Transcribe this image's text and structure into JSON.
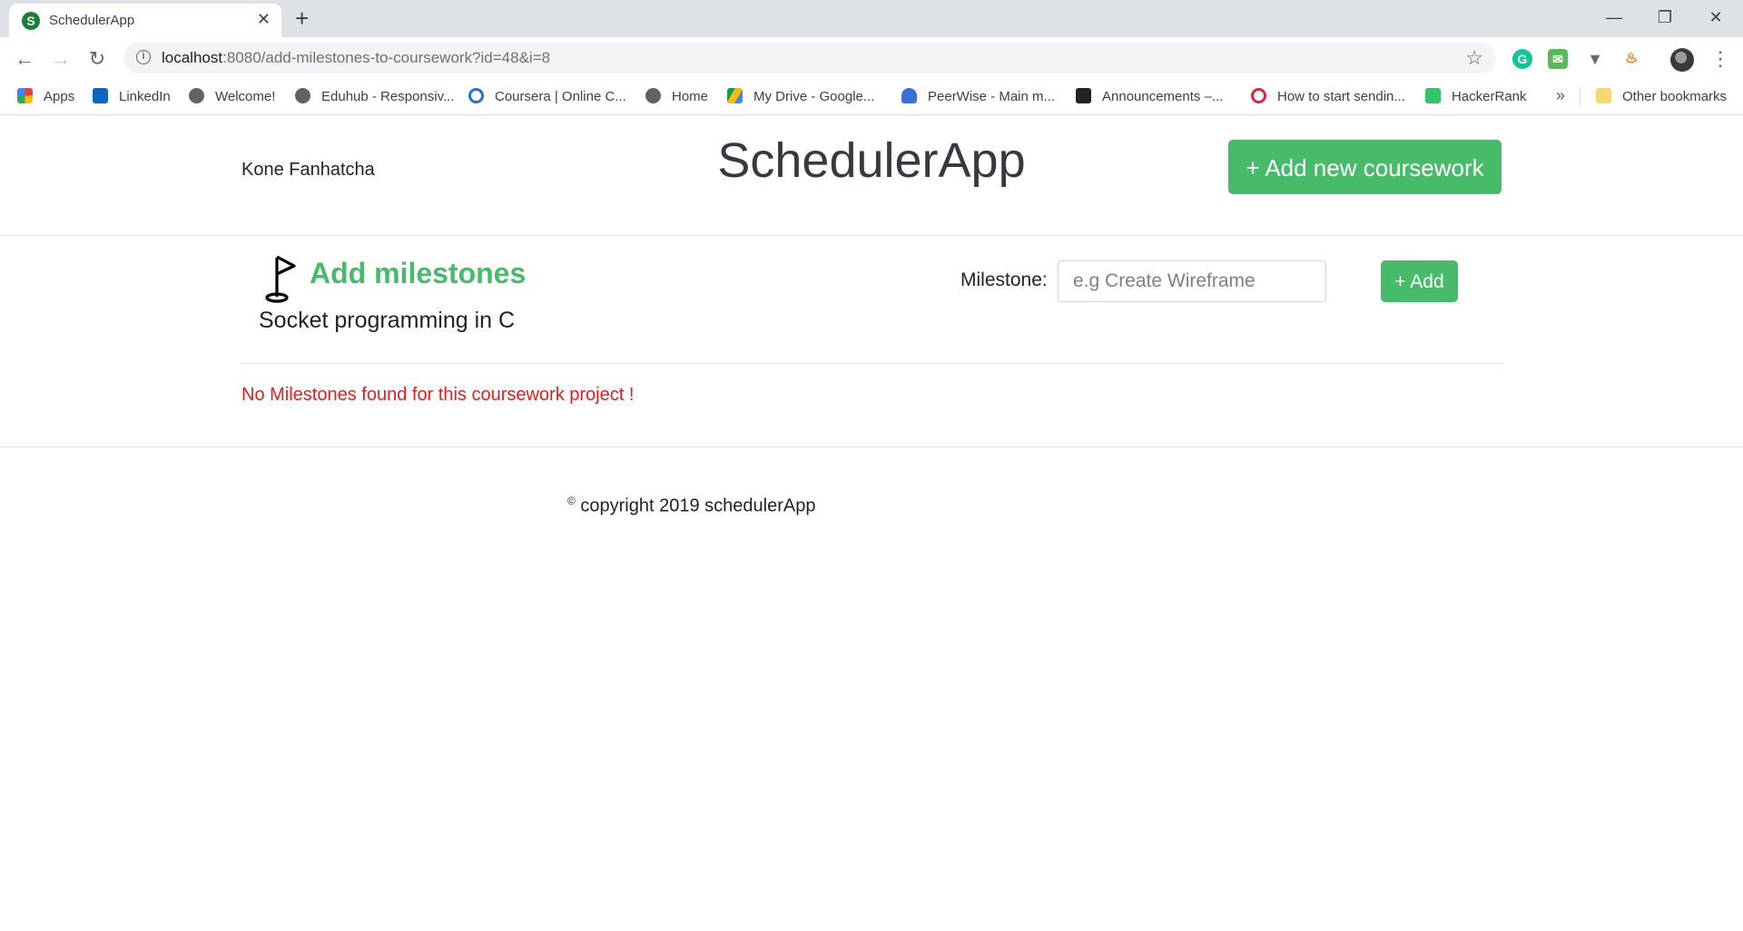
{
  "browser": {
    "tab_title": "SchedulerApp",
    "tab_favicon_letter": "S",
    "url_host": "localhost",
    "url_rest": ":8080/add-milestones-to-coursework?id=48&i=8"
  },
  "bookmarks": [
    {
      "label": "Apps",
      "icon": "apps-grid-icon"
    },
    {
      "label": "LinkedIn",
      "icon": "linkedin-icon"
    },
    {
      "label": "Welcome!",
      "icon": "globe-icon"
    },
    {
      "label": "Eduhub - Responsiv...",
      "icon": "globe-icon"
    },
    {
      "label": "Coursera | Online C...",
      "icon": "coursera-icon"
    },
    {
      "label": "Home",
      "icon": "globe-icon"
    },
    {
      "label": "My Drive - Google...",
      "icon": "drive-icon"
    },
    {
      "label": "PeerWise - Main m...",
      "icon": "peerwise-icon"
    },
    {
      "label": "Announcements –...",
      "icon": "blackboard-icon"
    },
    {
      "label": "How to start sendin...",
      "icon": "target-icon"
    },
    {
      "label": "HackerRank",
      "icon": "hackerrank-icon"
    }
  ],
  "bookmarks_other": "Other bookmarks",
  "bookmarks_more": "»",
  "header": {
    "user_name": "Kone Fanhatcha",
    "brand": "SchedulerApp",
    "add_coursework_label": "+ Add new coursework"
  },
  "milestones": {
    "title": "Add milestones",
    "coursework_name": "Socket programming in C",
    "field_label": "Milestone:",
    "field_placeholder": "e.g Create Wireframe",
    "field_value": "",
    "add_label": "+ Add",
    "empty_message": "No Milestones found for this coursework project !"
  },
  "footer": {
    "symbol": "©",
    "text": " copyright 2019 schedulerApp"
  },
  "colors": {
    "accent_green": "#48bb6b",
    "error_red": "#e51c1c"
  }
}
